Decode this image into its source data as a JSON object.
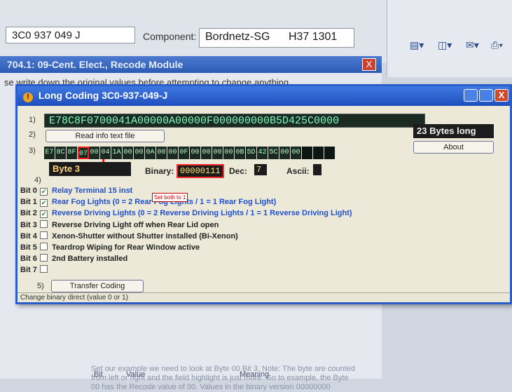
{
  "background": {
    "controller_code": "3C0 937 049 J",
    "component_label": "Component:",
    "component_name": "Bordnetz-SG",
    "component_code": "H37 1301"
  },
  "recode_window": {
    "title": "704.1: 09-Cent. Elect., Recode Module",
    "note": "se write down the original values before attempting to change anything",
    "close_glyph": "X",
    "bottom_note": "Set our example we need to look at Byte 00 Bit 3. Note: The byte are counted from left or right and the field highlight is just more. Go to example, the Byte 00 has the Recode value of 00. Values in the binary version 00000000",
    "bottom_cols": [
      "Bit",
      "Value",
      "Meaning"
    ]
  },
  "dialog": {
    "title": "Long Coding 3C0-937-049-J",
    "close_glyph": "X",
    "row_labels": [
      "1)",
      "2)",
      "3)",
      "4)",
      "5)"
    ],
    "coding_string": "E78C8F0700041A00000A00000F000000000B5D425C0000",
    "bytes_long": "23 Bytes long",
    "read_info_button": "Read info text file",
    "about_button": "About",
    "bytes": [
      "E7",
      "8C",
      "8F",
      "07",
      "00",
      "04",
      "1A",
      "00",
      "00",
      "0A",
      "00",
      "00",
      "0F",
      "00",
      "00",
      "00",
      "00",
      "0B",
      "5D",
      "42",
      "5C",
      "00",
      "00"
    ],
    "selected_byte_index": 3,
    "byte_label": "Byte 3",
    "binary_label": "Binary:",
    "binary_value": "00000111",
    "dec_label": "Dec:",
    "dec_value": "7",
    "ascii_label": "Ascii:",
    "ascii_value": "",
    "callout": "Set both to 1",
    "bits": [
      {
        "label": "Bit 0",
        "checked": true,
        "text": "Relay Terminal 15 inst",
        "active": true
      },
      {
        "label": "Bit 1",
        "checked": true,
        "text": "Rear Fog Lights (0 = 2 Rear Fog Lights / 1 = 1 Rear Fog Light)",
        "active": true
      },
      {
        "label": "Bit 2",
        "checked": true,
        "text": "Reverse Driving Lights (0 = 2 Reverse Driving Lights / 1 = 1 Reverse Driving Light)",
        "active": true
      },
      {
        "label": "Bit 3",
        "checked": false,
        "text": "Reverse Driving Light off when Rear Lid open",
        "active": false
      },
      {
        "label": "Bit 4",
        "checked": false,
        "text": "Xenon-Shutter without Shutter installed (Bi-Xenon)",
        "active": false
      },
      {
        "label": "Bit 5",
        "checked": false,
        "text": "Teardrop Wiping for Rear Window active",
        "active": false
      },
      {
        "label": "Bit 6",
        "checked": false,
        "text": "2nd Battery installed",
        "active": false
      },
      {
        "label": "Bit 7",
        "checked": false,
        "text": "",
        "active": false
      }
    ],
    "transfer_button": "Transfer Coding",
    "status": "Change binary direct (value 0 or 1)"
  }
}
